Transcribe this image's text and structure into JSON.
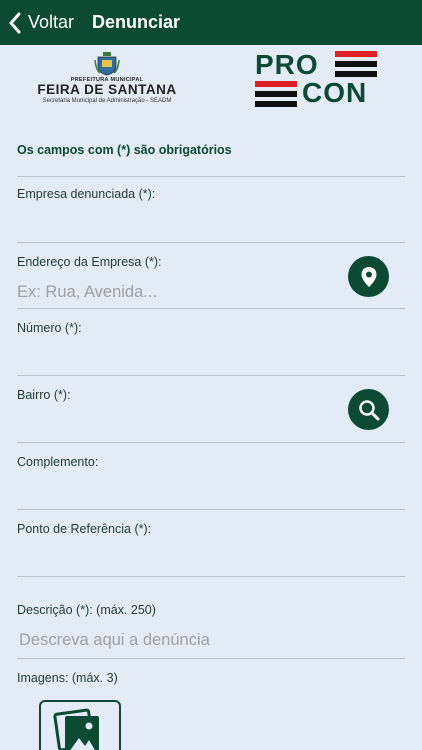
{
  "header": {
    "back_label": "Voltar",
    "title": "Denunciar"
  },
  "logos": {
    "feira": {
      "line1": "PREFEITURA MUNICIPAL",
      "line2": "FEIRA DE SANTANA",
      "line3": "Secretaria Municipal de Administração - SEADM"
    },
    "procon": {
      "top": "PRO",
      "bottom": "CON"
    }
  },
  "form": {
    "required_note": "Os campos com (*) são obrigatórios",
    "empresa": {
      "label": "Empresa denunciada (*):",
      "value": "",
      "placeholder": ""
    },
    "endereco": {
      "label": "Endereço da Empresa (*):",
      "value": "",
      "placeholder": "Ex: Rua, Avenida...",
      "button_icon": "location-pin-icon"
    },
    "numero": {
      "label": "Número (*):",
      "value": "",
      "placeholder": ""
    },
    "bairro": {
      "label": "Bairro (*):",
      "value": "",
      "placeholder": "",
      "button_icon": "search-icon"
    },
    "complemento": {
      "label": "Complemento:",
      "value": "",
      "placeholder": ""
    },
    "referencia": {
      "label": "Ponto de Referência (*):",
      "value": "",
      "placeholder": ""
    },
    "descricao": {
      "label": "Descrição (*): (máx. 250)",
      "value": "",
      "placeholder": "Descreva aqui a denúncia"
    },
    "imagens_label": "Imagens: (máx. 3)",
    "image_picker_icon": "image-gallery-icon"
  },
  "colors": {
    "primary": "#0c4a33",
    "background": "#e3ebf7",
    "procon_red": "#e11f26",
    "procon_black": "#111111"
  }
}
